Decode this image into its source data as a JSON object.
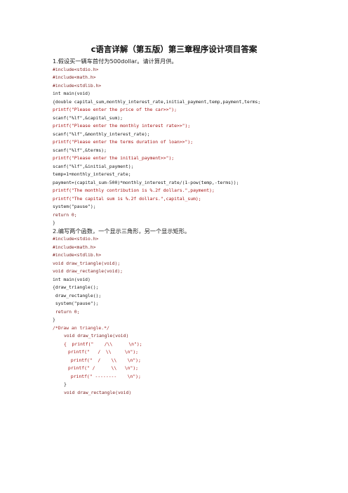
{
  "document": {
    "title": "c语言详解（第五版）第三章程序设计项目答案",
    "lines": [
      {
        "text": "1.假设买一辆车首付为500dollar。请计算月供。",
        "style": "cn",
        "indent": 0
      },
      {
        "text": "#include<stdio.h>",
        "style": "kw",
        "indent": 0
      },
      {
        "text": "#include<math.h>",
        "style": "kw",
        "indent": 0
      },
      {
        "text": "#include<stdlib.h>",
        "style": "kw",
        "indent": 0
      },
      {
        "text": "int main(void)",
        "style": "text",
        "indent": 0
      },
      {
        "text": "{double capital_sum,monthly_interest_rate,initial_payment,temp,payment,terms;",
        "style": "text",
        "indent": 0
      },
      {
        "text": "printf(\"Please enter the price of the car>>\");",
        "style": "str",
        "indent": 0
      },
      {
        "text": "scanf(\"%lf\",&capital_sum);",
        "style": "text",
        "indent": 0
      },
      {
        "text": "printf(\"Please enter the monthly interest rate>>\");",
        "style": "str",
        "indent": 0
      },
      {
        "text": "scanf(\"%lf\",&monthly_interest_rate);",
        "style": "text",
        "indent": 0
      },
      {
        "text": "printf(\"Please enter the terms duration of loan>>\");",
        "style": "str",
        "indent": 0
      },
      {
        "text": "scanf(\"%lf\",&terms);",
        "style": "text",
        "indent": 0
      },
      {
        "text": "printf(\"Please enter the initial_payment>>\");",
        "style": "str",
        "indent": 0
      },
      {
        "text": "scanf(\"%lf\",&initial_payment);",
        "style": "text",
        "indent": 0
      },
      {
        "text": "temp=1+monthly_interest_rate;",
        "style": "text",
        "indent": 0
      },
      {
        "text": "payment=(capital_sum-500)*monthly_interest_rate/(1-pow(temp,-terms));",
        "style": "text",
        "indent": 0
      },
      {
        "text": "printf(\"The monthly contribution is %.2f dollars.\",payment);",
        "style": "str",
        "indent": 0
      },
      {
        "text": "printf(\"The capital sum is %.2f dollars.\",capital_sum);",
        "style": "str",
        "indent": 0
      },
      {
        "text": "system(\"pause\");",
        "style": "text",
        "indent": 0
      },
      {
        "text": "return 0;",
        "style": "kw",
        "indent": 0
      },
      {
        "text": "}",
        "style": "text",
        "indent": 0
      },
      {
        "text": "2.编写两个函数，一个显示三角形，另一个显示矩形。",
        "style": "cn",
        "indent": 0
      },
      {
        "text": "#include<stdio.h>",
        "style": "kw",
        "indent": 0
      },
      {
        "text": "#include<math.h>",
        "style": "kw",
        "indent": 0
      },
      {
        "text": "#include<stdlib.h>",
        "style": "kw",
        "indent": 0
      },
      {
        "text": "void draw_triangle(void);",
        "style": "kw",
        "indent": 0
      },
      {
        "text": "void draw_rectangle(void);",
        "style": "kw",
        "indent": 0
      },
      {
        "text": "int main(void)",
        "style": "text",
        "indent": 0
      },
      {
        "text": "{draw_triangle();",
        "style": "text",
        "indent": 0
      },
      {
        "text": " draw_rectangle();",
        "style": "text",
        "indent": 0
      },
      {
        "text": " system(\"pause\");",
        "style": "text",
        "indent": 0
      },
      {
        "text": " return 0;",
        "style": "kw",
        "indent": 0
      },
      {
        "text": "}",
        "style": "text",
        "indent": 0
      },
      {
        "text": "/*Draw an triangle.*/",
        "style": "cmt",
        "indent": 0
      },
      {
        "text": "void draw_triangle(void)",
        "style": "kw",
        "indent": 1
      },
      {
        "text": "{  printf(\"    /\\\\      \\n\");",
        "style": "str",
        "indent": 1
      },
      {
        "text": "printf(\"   /  \\\\     \\n\");",
        "style": "str",
        "indent": 2
      },
      {
        "text": " printf(\"  /    \\\\    \\n\");",
        "style": "str",
        "indent": 2
      },
      {
        "text": "printf(\" /      \\\\   \\n\");",
        "style": "str",
        "indent": 2
      },
      {
        "text": " printf(\" --------    \\n\");",
        "style": "str",
        "indent": 2
      },
      {
        "text": "}",
        "style": "text",
        "indent": 1
      },
      {
        "text": "void draw_rectangle(void)",
        "style": "kw",
        "indent": 1
      }
    ]
  }
}
